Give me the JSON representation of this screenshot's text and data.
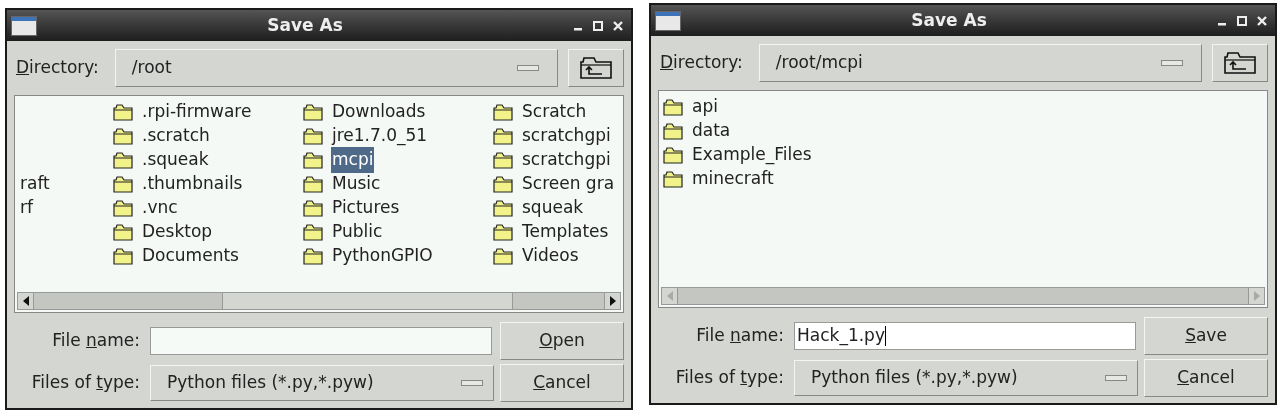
{
  "dialogs": [
    {
      "title": "Save As",
      "directory": {
        "label": {
          "key": "D",
          "rest": "irectory:"
        },
        "value": "/root"
      },
      "file_list": {
        "columns": [
          {
            "items": [
              {
                "kind": "blank"
              },
              {
                "kind": "blank"
              },
              {
                "kind": "blank"
              },
              {
                "kind": "text",
                "name": "raft",
                "selected": false
              },
              {
                "kind": "text",
                "name": "rf",
                "selected": false
              }
            ]
          },
          {
            "items": [
              {
                "kind": "folder",
                "name": ".rpi-firmware",
                "selected": false
              },
              {
                "kind": "folder",
                "name": ".scratch",
                "selected": false
              },
              {
                "kind": "folder",
                "name": ".squeak",
                "selected": false
              },
              {
                "kind": "folder",
                "name": ".thumbnails",
                "selected": false
              },
              {
                "kind": "folder",
                "name": ".vnc",
                "selected": false
              },
              {
                "kind": "folder",
                "name": "Desktop",
                "selected": false
              },
              {
                "kind": "folder",
                "name": "Documents",
                "selected": false
              }
            ]
          },
          {
            "items": [
              {
                "kind": "folder",
                "name": "Downloads",
                "selected": false
              },
              {
                "kind": "folder",
                "name": "jre1.7.0_51",
                "selected": false
              },
              {
                "kind": "folder",
                "name": "mcpi",
                "selected": true
              },
              {
                "kind": "folder",
                "name": "Music",
                "selected": false
              },
              {
                "kind": "folder",
                "name": "Pictures",
                "selected": false
              },
              {
                "kind": "folder",
                "name": "Public",
                "selected": false
              },
              {
                "kind": "folder",
                "name": "PythonGPIO",
                "selected": false
              }
            ]
          },
          {
            "items": [
              {
                "kind": "folder",
                "name": "Scratch",
                "selected": false
              },
              {
                "kind": "folder",
                "name": "scratchgpi",
                "selected": false
              },
              {
                "kind": "folder",
                "name": "scratchgpi",
                "selected": false
              },
              {
                "kind": "folder",
                "name": "Screen gra",
                "selected": false
              },
              {
                "kind": "folder",
                "name": "squeak",
                "selected": false
              },
              {
                "kind": "folder",
                "name": "Templates",
                "selected": false
              },
              {
                "kind": "folder",
                "name": "Videos",
                "selected": false
              }
            ]
          }
        ],
        "scrollbar": {
          "disabled": false
        }
      },
      "file_name": {
        "label": {
          "lead": "File ",
          "key": "n",
          "rest": "ame:"
        },
        "focused": false
      },
      "file_type": {
        "label": {
          "lead": "Files of ",
          "key": "t",
          "rest": "ype:"
        },
        "value": "Python files (*.py,*.pyw)"
      },
      "buttons": [
        {
          "key": "O",
          "rest": "pen"
        },
        {
          "key": "C",
          "rest": "ancel"
        }
      ]
    },
    {
      "title": "Save As",
      "directory": {
        "label": {
          "key": "D",
          "rest": "irectory:"
        },
        "value": "/root/mcpi"
      },
      "file_list": {
        "columns": [
          {
            "items": [
              {
                "kind": "folder",
                "name": "api",
                "selected": false
              },
              {
                "kind": "folder",
                "name": "data",
                "selected": false
              },
              {
                "kind": "folder",
                "name": "Example_Files",
                "selected": false
              },
              {
                "kind": "folder",
                "name": "minecraft",
                "selected": false
              }
            ]
          }
        ],
        "scrollbar": {
          "disabled": true
        }
      },
      "file_name": {
        "label": {
          "lead": "File ",
          "key": "n",
          "rest": "ame:"
        },
        "value": "Hack_1.py",
        "focused": true
      },
      "file_type": {
        "label": {
          "lead": "Files of ",
          "key": "t",
          "rest": "ype:"
        },
        "value": "Python files (*.py,*.pyw)"
      },
      "buttons": [
        {
          "key": "S",
          "rest": "ave"
        },
        {
          "key": "C",
          "rest": "ancel"
        }
      ]
    }
  ]
}
